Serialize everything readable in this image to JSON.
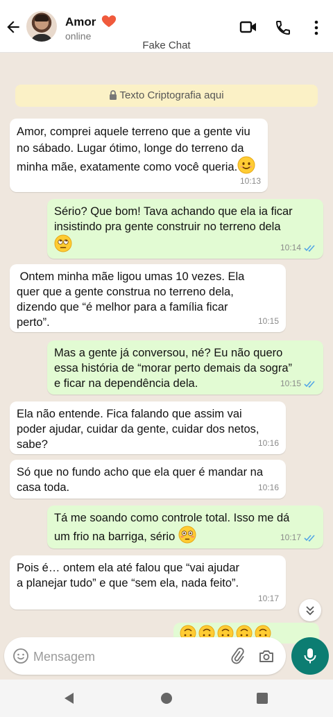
{
  "header": {
    "contact_name": "Amor",
    "status": "online",
    "app_title": "Fake Chat"
  },
  "encryption_notice": "Texto Criptografia aqui",
  "messages": [
    {
      "direction": "in",
      "text": "Amor, comprei aquele terreno que a gente viu\nno sábado. Lugar ótimo, longe do terreno da\nminha mãe, exatamente como você queria.",
      "emoji": "smiling-face",
      "time": "10:13"
    },
    {
      "direction": "out",
      "text": "Sério? Que bom! Tava achando que ela ia ficar\ninsistindo pra gente construir no terreno dela",
      "emoji": "eye-roll-face",
      "time": "10:14",
      "status": "read"
    },
    {
      "direction": "in",
      "text": " Ontem minha mãe ligou umas 10 vezes. Ela\nquer que a gente construa no terreno dela,\ndizendo que “é melhor para a família ficar\nperto”.",
      "time": "10:15"
    },
    {
      "direction": "out",
      "text": "Mas a gente já conversou, né? Eu não quero\nessa história de “morar perto demais da sogra”\ne ficar na dependência dela.",
      "time": "10:15",
      "status": "read"
    },
    {
      "direction": "in",
      "text": "Ela não entende. Fica falando que assim vai\npoder ajudar, cuidar da gente, cuidar dos netos,\nsabe?",
      "time": "10:16"
    },
    {
      "direction": "in",
      "text": "Só que no fundo acho que ela quer é mandar na\ncasa toda.",
      "time": "10:16"
    },
    {
      "direction": "out",
      "text": "Tá me soando como controle total. Isso me dá\num frio na barriga, sério",
      "emoji": "flushed-face",
      "time": "10:17",
      "status": "read"
    },
    {
      "direction": "in",
      "text": "Pois é… ontem ela até falou que “vai ajudar\na planejar tudo” e que “sem ela, nada feito”.",
      "time": "10:17"
    }
  ],
  "partial_message": {
    "emoji": "upside-down-face",
    "count": 5
  },
  "composer": {
    "placeholder": "Mensagem"
  },
  "colors": {
    "incoming_bubble": "#ffffff",
    "outgoing_bubble": "#e2fbd3",
    "read_ticks": "#53a6e6",
    "accent": "#0c7d72",
    "encryption_bg": "#fbf1c6"
  }
}
